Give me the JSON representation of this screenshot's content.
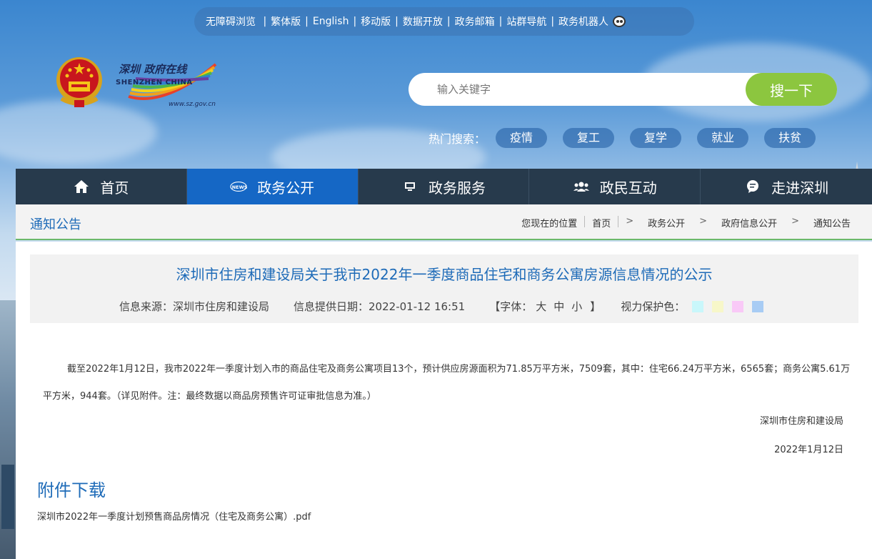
{
  "toplinks": [
    "无障碍浏览",
    "繁体版",
    "English",
    "移动版",
    "数据开放",
    "政务邮箱",
    "站群导航",
    "政务机器人"
  ],
  "logo": {
    "cn": "深圳 政府在线",
    "en": "SHENZHEN CHINA",
    "url": "www.sz.gov.cn"
  },
  "search": {
    "placeholder": "输入关键字",
    "button": "搜一下"
  },
  "hot": {
    "label": "热门搜索：",
    "tags": [
      "疫情",
      "复工",
      "复学",
      "就业",
      "扶贫"
    ]
  },
  "nav": [
    {
      "label": "首页",
      "icon": "home-icon"
    },
    {
      "label": "政务公开",
      "icon": "news-icon"
    },
    {
      "label": "政务服务",
      "icon": "monitor-icon"
    },
    {
      "label": "政民互动",
      "icon": "people-icon"
    },
    {
      "label": "走进深圳",
      "icon": "chat-icon"
    }
  ],
  "section_title": "通知公告",
  "breadcrumb": {
    "label": "您现在的位置",
    "items": [
      "首页",
      "政务公开",
      "政府信息公开",
      "通知公告"
    ]
  },
  "article": {
    "title": "深圳市住房和建设局关于我市2022年一季度商品住宅和商务公寓房源信息情况的公示",
    "source": "信息来源：深圳市住房和建设局",
    "date": "信息提供日期：2022-01-12 16:51",
    "font_open": "【字体：",
    "font_sizes": [
      "大",
      "中",
      "小"
    ],
    "font_close": "】",
    "eye_label": "视力保护色：",
    "eye_colors": [
      "#c9f7fb",
      "#f7f7c9",
      "#f9c9f7",
      "#a8ccf4"
    ],
    "body": "截至2022年1月12日，我市2022年一季度计划入市的商品住宅及商务公寓项目13个，预计供应房源面积为71.85万平方米，7509套，其中：住宅66.24万平方米，6565套；商务公寓5.61万平方米，944套。（详见附件。注：最终数据以商品房预售许可证审批信息为准。）",
    "signer": "深圳市住房和建设局",
    "sign_date": "2022年1月12日"
  },
  "attachments": {
    "title": "附件下载",
    "file": "深圳市2022年一季度计划预售商品房情况（住宅及商务公寓）.pdf"
  }
}
